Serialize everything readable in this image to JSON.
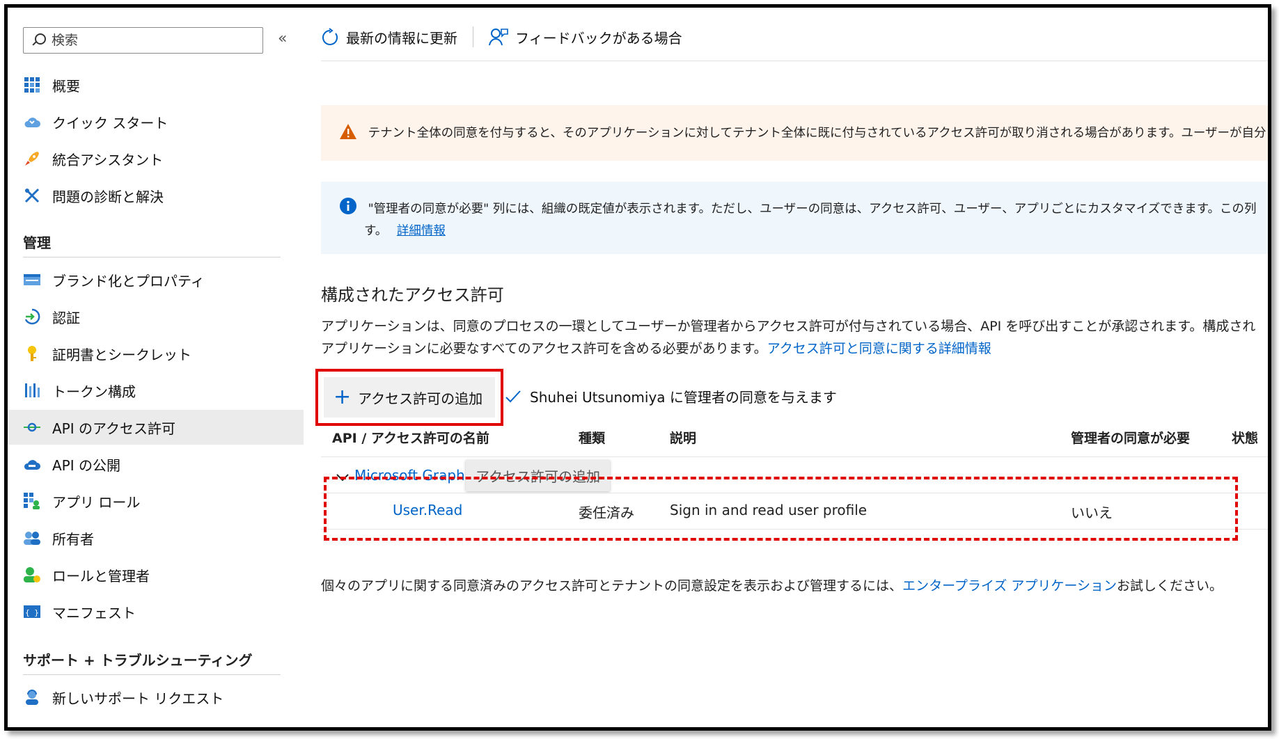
{
  "sidebar": {
    "search_placeholder": "検索",
    "collapse_glyph": "«",
    "items": [
      {
        "label": "概要",
        "icon": "grid-overview-icon"
      },
      {
        "label": "クイック スタート",
        "icon": "cloud-quickstart-icon"
      },
      {
        "label": "統合アシスタント",
        "icon": "rocket-icon"
      },
      {
        "label": "問題の診断と解決",
        "icon": "wrench-cross-icon"
      }
    ],
    "section_manage": "管理",
    "manage_items": [
      {
        "label": "ブランド化とプロパティ",
        "icon": "branding-icon"
      },
      {
        "label": "認証",
        "icon": "authentication-icon"
      },
      {
        "label": "証明書とシークレット",
        "icon": "key-icon"
      },
      {
        "label": "トークン構成",
        "icon": "token-bars-icon"
      },
      {
        "label": "API のアクセス許可",
        "icon": "api-permission-icon",
        "active": true
      },
      {
        "label": "API の公開",
        "icon": "cloud-expose-icon"
      },
      {
        "label": "アプリ ロール",
        "icon": "app-roles-icon"
      },
      {
        "label": "所有者",
        "icon": "owners-icon"
      },
      {
        "label": "ロールと管理者",
        "icon": "roles-admins-icon"
      },
      {
        "label": "マニフェスト",
        "icon": "manifest-icon"
      }
    ],
    "section_support": "サポート + トラブルシューティング",
    "support_items": [
      {
        "label": "新しいサポート リクエスト",
        "icon": "support-person-icon"
      }
    ]
  },
  "toolbar": {
    "refresh_label": "最新の情報に更新",
    "feedback_label": "フィードバックがある場合"
  },
  "warning_banner": {
    "text": "テナント全体の同意を付与すると、そのアプリケーションに対してテナント全体に既に付与されているアクセス許可が取り消される場合があります。ユーザーが自分"
  },
  "info_banner": {
    "line1": "\"管理者の同意が必要\" 列には、組織の既定値が表示されます。ただし、ユーザーの同意は、アクセス許可、ユーザー、アプリごとにカスタマイズできます。この列",
    "line2_prefix": "す。",
    "link": "詳細情報"
  },
  "configured": {
    "title": "構成されたアクセス許可",
    "desc_line1": "アプリケーションは、同意のプロセスの一環としてユーザーか管理者からアクセス許可が付与されている場合、API を呼び出すことが承認されます。構成され",
    "desc_line2": "アプリケーションに必要なすべてのアクセス許可を含める必要があります。",
    "desc_link": "アクセス許可と同意に関する詳細情報"
  },
  "actions": {
    "add_permission": "アクセス許可の追加",
    "grant_consent": "Shuhei Utsunomiya に管理者の同意を与えます"
  },
  "table": {
    "headers": [
      "API / アクセス許可の名前",
      "種類",
      "説明",
      "管理者の同意が必要",
      "状態"
    ],
    "group": "Microsoft Graph",
    "tooltip": "アクセス許可の追加",
    "rows": [
      {
        "name": "User.Read",
        "type": "委任済み",
        "description": "Sign in and read user profile",
        "admin_consent": "いいえ"
      }
    ]
  },
  "footer": {
    "prefix": "個々のアプリに関する同意済みのアクセス許可とテナントの同意設定を表示および管理するには、",
    "link": "エンタープライズ アプリケーション",
    "suffix": "お試しください。"
  },
  "colors": {
    "accent": "#0064c8",
    "highlight_red": "#e00000",
    "warning_bg": "#fff4ec",
    "info_bg": "#eff6fc",
    "warning_icon": "#d65e00",
    "info_icon": "#0064c8"
  }
}
